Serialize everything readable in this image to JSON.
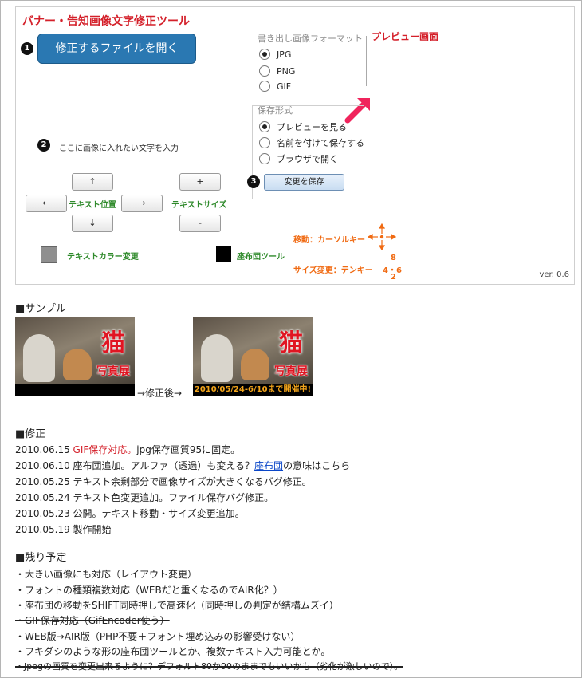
{
  "tool": {
    "title": "バナー・告知画像文字修正ツール",
    "step1_num": "1",
    "open_button": "修正するファイルを開く",
    "step2_num": "2",
    "step2_hint": "ここに画像に入れたい文字を入力",
    "arrow_up": "↑",
    "arrow_left": "←",
    "arrow_right": "→",
    "arrow_down": "↓",
    "text_position": "テキスト位置",
    "plus": "+",
    "minus": "-",
    "text_size": "テキストサイズ",
    "text_color": "テキストカラー変更",
    "zabuton": "座布団ツール",
    "export_format_label": "書き出し画像フォーマット",
    "formats": [
      "JPG",
      "PNG",
      "GIF"
    ],
    "selected_format": "JPG",
    "preview_label": "プレビュー画面",
    "save_format_label": "保存形式",
    "save_options": [
      "プレビューを見る",
      "名前を付けて保存する",
      "ブラウザで開く"
    ],
    "selected_save": "プレビューを見る",
    "step3_num": "3",
    "save_button": "変更を保存",
    "move_hint": "移動：カーソルキー",
    "size_hint": "サイズ変更：テンキー",
    "numpad_8": "8",
    "numpad_4_6": "4・6",
    "numpad_2": "2",
    "version": "ver. 0.6"
  },
  "sample": {
    "heading": "■サンプル",
    "img_kanji": "猫",
    "img_label": "写真展",
    "after_band": "2010/05/24-6/10まで開催中!",
    "arrow_text": "→修正後→"
  },
  "changelog": {
    "heading": "■修正",
    "l1_date": "2010.06.15",
    "l1_red": "GIF保存対応。",
    "l1_rest": "jpg保存画質95に固定。",
    "l2_pre": "2010.06.10 座布団追加。アルファ（透過）も変える？",
    "l2_link": "座布団",
    "l2_post": "の意味はこちら",
    "l3": "2010.05.25 テキスト余剰部分で画像サイズが大きくなるバグ修正。",
    "l4": "2010.05.24 テキスト色変更追加。ファイル保存バグ修正。",
    "l5": "2010.05.23 公開。テキスト移動・サイズ変更追加。",
    "l6": "2010.05.19 製作開始"
  },
  "todo": {
    "heading": "■残り予定",
    "t1": "・大きい画像にも対応（レイアウト変更）",
    "t2": "・フォントの種類複数対応（WEBだと重くなるのでAIR化？）",
    "t3": "・座布団の移動をSHIFT同時押しで高速化（同時押しの判定が結構ムズイ）",
    "t4": "・GIF保存対応（GifEncoder使う）",
    "t5": "・WEB版→AIR版（PHP不要＋フォント埋め込みの影響受けない）",
    "t6": "・フキダシのような形の座布団ツールとか、複数テキスト入力可能とか。",
    "t7": "・Jpegの画質を変更出来るように？デフォルト80か90のままでもいいかも（劣化が激しいので）。"
  }
}
